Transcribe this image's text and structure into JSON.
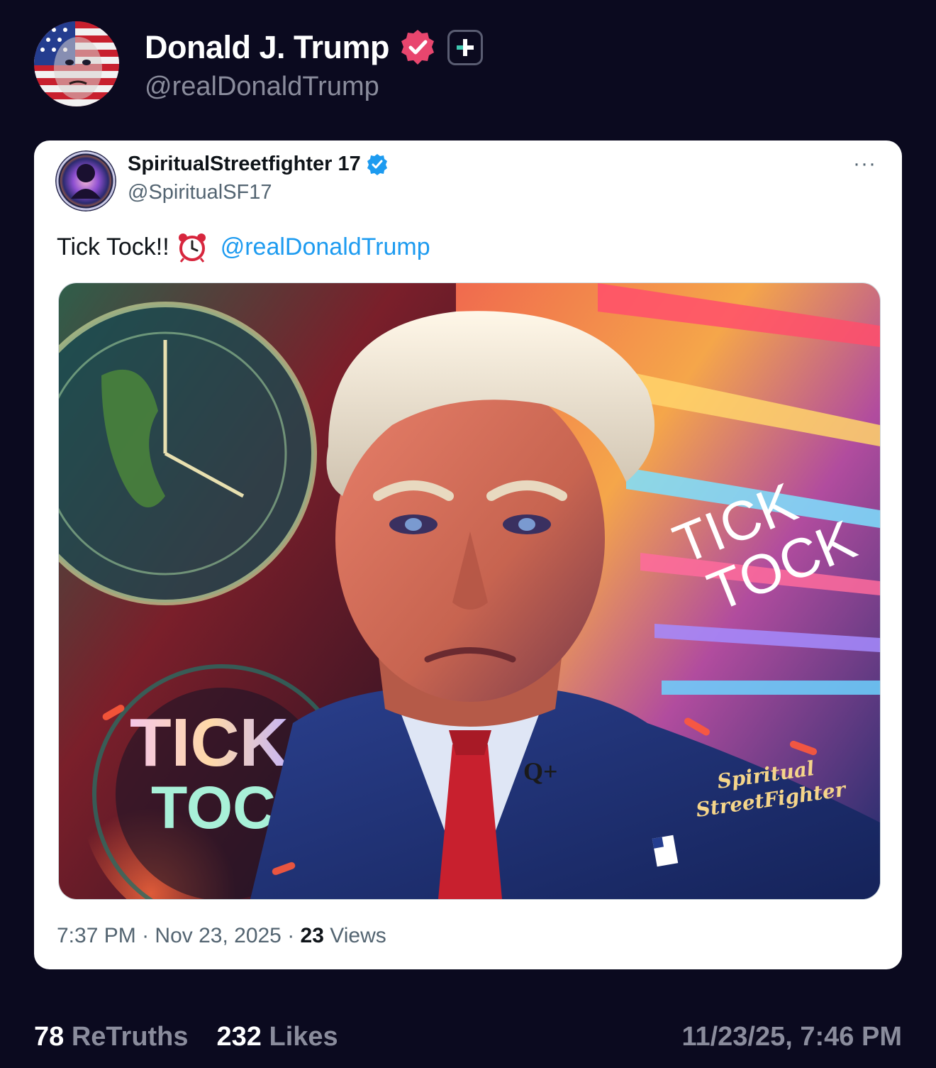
{
  "post": {
    "author": {
      "display_name": "Donald J. Trump",
      "handle": "@realDonaldTrump",
      "verified_color": "#e8466e",
      "avatar_icon": "flag-portrait-avatar"
    },
    "plus_icon": "plus-icon"
  },
  "embed": {
    "author": {
      "display_name": "SpiritualStreetfighter 17",
      "handle": "@SpiritualSF17",
      "verified_color": "#1d9bf0"
    },
    "more_label": "···",
    "text": "Tick Tock!!",
    "emoji_icon": "alarm-clock-icon",
    "mention": "@realDonaldTrump",
    "image": {
      "overlay_text_left_1": "TICK",
      "overlay_text_left_2": "TOCK",
      "overlay_text_right_1": "TICK",
      "overlay_text_right_2": "TOCK",
      "pin_text": "Q+",
      "signature_1": "Spiritual",
      "signature_2": "StreetFighter"
    },
    "meta": {
      "time": "7:37 PM",
      "sep1": " · ",
      "date": "Nov 23, 2025",
      "sep2": " · ",
      "views_count": "23",
      "views_label": " Views"
    }
  },
  "footer": {
    "retruths_count": "78",
    "retruths_label": " ReTruths",
    "likes_count": "232",
    "likes_label": " Likes",
    "timestamp": "11/23/25, 7:46 PM"
  },
  "colors": {
    "background": "#0b0a1f",
    "card": "#ffffff",
    "link": "#1d9bf0",
    "muted": "#8a8c9c"
  }
}
